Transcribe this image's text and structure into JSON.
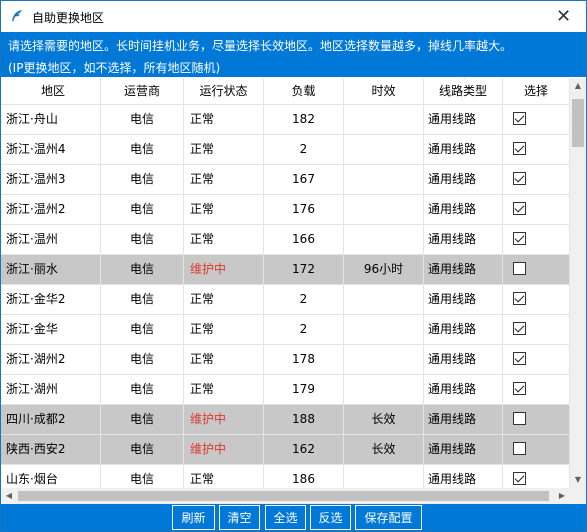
{
  "window": {
    "title": "自助更换地区",
    "close_glyph": "✕"
  },
  "notice": {
    "line1": "请选择需要的地区。长时间挂机业务，尽量选择长效地区。地区选择数量越多，掉线几率越大。",
    "line2": "(IP更换地区，如不选择，所有地区随机)"
  },
  "table": {
    "columns": [
      "地区",
      "运营商",
      "运行状态",
      "负载",
      "时效",
      "线路类型",
      "选择"
    ],
    "sort_indicator": "^",
    "rows": [
      {
        "region": "浙江·舟山",
        "carrier": "电信",
        "status": "正常",
        "load": "182",
        "expire": "",
        "line": "通用线路",
        "checked": true,
        "maint": false
      },
      {
        "region": "浙江·温州4",
        "carrier": "电信",
        "status": "正常",
        "load": "2",
        "expire": "",
        "line": "通用线路",
        "checked": true,
        "maint": false
      },
      {
        "region": "浙江·温州3",
        "carrier": "电信",
        "status": "正常",
        "load": "167",
        "expire": "",
        "line": "通用线路",
        "checked": true,
        "maint": false
      },
      {
        "region": "浙江·温州2",
        "carrier": "电信",
        "status": "正常",
        "load": "176",
        "expire": "",
        "line": "通用线路",
        "checked": true,
        "maint": false
      },
      {
        "region": "浙江·温州",
        "carrier": "电信",
        "status": "正常",
        "load": "166",
        "expire": "",
        "line": "通用线路",
        "checked": true,
        "maint": false
      },
      {
        "region": "浙江·丽水",
        "carrier": "电信",
        "status": "维护中",
        "load": "172",
        "expire": "96小时",
        "line": "通用线路",
        "checked": false,
        "maint": true
      },
      {
        "region": "浙江·金华2",
        "carrier": "电信",
        "status": "正常",
        "load": "2",
        "expire": "",
        "line": "通用线路",
        "checked": true,
        "maint": false
      },
      {
        "region": "浙江·金华",
        "carrier": "电信",
        "status": "正常",
        "load": "2",
        "expire": "",
        "line": "通用线路",
        "checked": true,
        "maint": false
      },
      {
        "region": "浙江·湖州2",
        "carrier": "电信",
        "status": "正常",
        "load": "178",
        "expire": "",
        "line": "通用线路",
        "checked": true,
        "maint": false
      },
      {
        "region": "浙江·湖州",
        "carrier": "电信",
        "status": "正常",
        "load": "179",
        "expire": "",
        "line": "通用线路",
        "checked": true,
        "maint": false
      },
      {
        "region": "四川·成都2",
        "carrier": "电信",
        "status": "维护中",
        "load": "188",
        "expire": "长效",
        "line": "通用线路",
        "checked": false,
        "maint": true
      },
      {
        "region": "陕西·西安2",
        "carrier": "电信",
        "status": "维护中",
        "load": "162",
        "expire": "长效",
        "line": "通用线路",
        "checked": false,
        "maint": true
      },
      {
        "region": "山东·烟台",
        "carrier": "电信",
        "status": "正常",
        "load": "186",
        "expire": "",
        "line": "通用线路",
        "checked": true,
        "maint": false
      }
    ]
  },
  "buttons": {
    "refresh": "刷新",
    "clear": "清空",
    "select_all": "全选",
    "invert": "反选",
    "save": "保存配置"
  },
  "colors": {
    "accent": "#0078d7",
    "maintenance_text": "#e0392b",
    "maintenance_row": "#c8c8c8"
  },
  "icons": {
    "app": "feather-icon",
    "close": "close-icon",
    "checkbox": "checkbox-icon"
  }
}
